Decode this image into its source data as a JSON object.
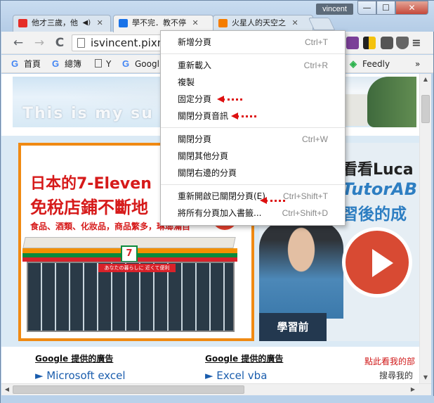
{
  "window": {
    "user_name": "vincent",
    "min_glyph": "—",
    "max_glyph": "☐",
    "close_glyph": "✕"
  },
  "tabs": [
    {
      "title": "他才三歲，他",
      "audio": "◀)",
      "close": "✕",
      "favicon_color": "#e52d27"
    },
    {
      "title": "學不完．教不停",
      "close": "✕",
      "favicon_color": "#1a73e8"
    },
    {
      "title": "火星人的天空之",
      "close": "✕",
      "favicon_color": "#f57d00"
    }
  ],
  "toolbar": {
    "back": "←",
    "forward": "→",
    "reload": "C",
    "url": "isvincent.pixn",
    "menu": "≡"
  },
  "bookmarks": [
    {
      "label": "首頁",
      "icon": "G"
    },
    {
      "label": "總簿",
      "icon": "G"
    },
    {
      "label": "Y",
      "icon": "page"
    },
    {
      "label": "Googl",
      "icon": "G"
    },
    {
      "label": "Feedly",
      "icon": "feedly"
    },
    {
      "label": "»",
      "icon": "none"
    }
  ],
  "banner": {
    "text": "This is my su"
  },
  "ad_left": {
    "line1": "日本的7-Eleven",
    "line2": "免稅店鋪不斷地",
    "line3": "食品、酒類、化妝品，商品繁多，琳瑯滿目",
    "sign": "7",
    "awning": "あなたの暮らしに 近くて便利"
  },
  "ad_right": {
    "line1": "看看Luca",
    "line2": "TutorAB",
    "line3": "習後的成",
    "caption": "學習前"
  },
  "footer": {
    "google_ads_1": "Google 提供的廣告",
    "google_ads_2": "Google 提供的廣告",
    "link_1": "► Microsoft excel",
    "link_2": "► Excel vba",
    "right_note": "點此看我的部",
    "right_note2": "搜尋我的"
  },
  "context_menu": {
    "items": [
      {
        "label": "新增分頁",
        "shortcut": "Ctrl+T"
      },
      {
        "label": "重新載入",
        "shortcut": "Ctrl+R"
      },
      {
        "label": "複製",
        "shortcut": ""
      },
      {
        "label": "固定分頁",
        "shortcut": ""
      },
      {
        "label": "關閉分頁音訊",
        "shortcut": ""
      },
      {
        "label": "關閉分頁",
        "shortcut": "Ctrl+W"
      },
      {
        "label": "關閉其他分頁",
        "shortcut": ""
      },
      {
        "label": "關閉右邊的分頁",
        "shortcut": ""
      },
      {
        "label": "重新開啟已關閉分頁(E)",
        "shortcut": "Ctrl+Shift+T"
      },
      {
        "label": "將所有分頁加入書籤...",
        "shortcut": "Ctrl+Shift+D"
      }
    ]
  },
  "colors": {
    "accent_red": "#d11111",
    "link_blue": "#1a5dad",
    "orange_border": "#f08a13"
  }
}
